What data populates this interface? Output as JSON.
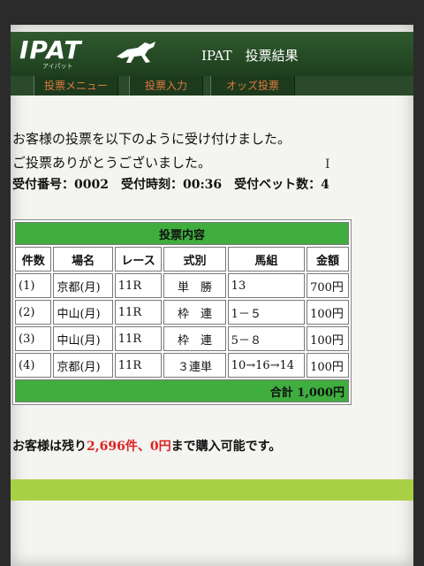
{
  "header": {
    "logo": "IPAT",
    "logo_sub": "アイパット",
    "title": "IPAT　投票結果"
  },
  "nav": {
    "items": [
      "投票メニュー",
      "投票入力",
      "オッズ投票"
    ]
  },
  "message": {
    "line1": "お客様の投票を以下のように受け付けました。",
    "line2": "ご投票ありがとうございました。",
    "receipt": "受付番号：0002　受付時刻：00:36　受付ベット数：4"
  },
  "table": {
    "title": "投票内容",
    "headers": [
      "件数",
      "場名",
      "レース",
      "式別",
      "馬組",
      "金額"
    ],
    "rows": [
      {
        "no": "(1)",
        "venue": "京都(月)",
        "race": "11R",
        "type": "単　勝",
        "combo": "13",
        "amount": "700円"
      },
      {
        "no": "(2)",
        "venue": "中山(月)",
        "race": "11R",
        "type": "枠　連",
        "combo": "1－５",
        "amount": "100円"
      },
      {
        "no": "(3)",
        "venue": "中山(月)",
        "race": "11R",
        "type": "枠　連",
        "combo": "5－８",
        "amount": "100円"
      },
      {
        "no": "(4)",
        "venue": "京都(月)",
        "race": "11R",
        "type": "３連単",
        "combo": "10→16→14",
        "amount": "100円"
      }
    ],
    "total": "合計 1,000円"
  },
  "remaining": {
    "prefix": "お客様は残り",
    "count": "2,696件、0円",
    "suffix": "まで購入可能です。"
  },
  "colors": {
    "header_bg": "#1e3f1e",
    "nav_text": "#e07a40",
    "table_green": "#3fae3f",
    "highlight_red": "#d22222",
    "bottom_bar": "#a9cf45"
  }
}
